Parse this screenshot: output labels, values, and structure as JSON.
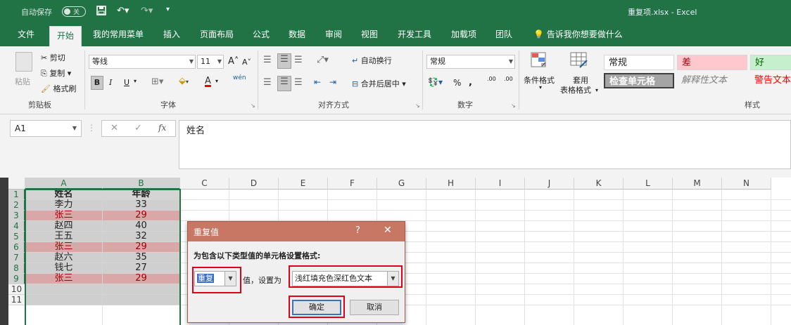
{
  "title_bar": {
    "autosave_label": "自动保存",
    "autosave_state": "关",
    "save_icon": "save-icon",
    "undo_icon": "undo-icon",
    "redo_icon": "redo-icon",
    "doc_title": "重复项.xlsx  -  Excel"
  },
  "tabs": [
    "文件",
    "开始",
    "我的常用菜单",
    "插入",
    "页面布局",
    "公式",
    "数据",
    "审阅",
    "视图",
    "开发工具",
    "加载项",
    "团队"
  ],
  "active_tab": "开始",
  "tell_me": "告诉我你想要做什么",
  "ribbon": {
    "clipboard": {
      "paste": "粘贴",
      "cut": "剪切",
      "copy": "复制",
      "format_painter": "格式刷",
      "label": "剪贴板"
    },
    "font": {
      "name": "等线",
      "size": "11",
      "grow": "A",
      "shrink": "A",
      "bold": "B",
      "italic": "I",
      "underline": "U",
      "phonetic": "wén",
      "font_color": "A",
      "label": "字体"
    },
    "alignment": {
      "wrap": "自动换行",
      "merge": "合并后居中",
      "label": "对齐方式"
    },
    "number": {
      "format": "常规",
      "percent": "%",
      "comma": ",",
      "inc_dec": ".00",
      "label": "数字"
    },
    "styles": {
      "conditional": "条件格式",
      "table_format_1": "套用",
      "table_format_2": "表格格式",
      "normal": "常规",
      "bad": "差",
      "good": "好",
      "check_cell": "检查单元格",
      "explanatory": "解释性文本",
      "warning": "警告文本",
      "label": "样式"
    }
  },
  "formula_bar": {
    "cell_ref": "A1",
    "cancel": "✕",
    "enter": "✓",
    "fx": "fx",
    "value": "姓名"
  },
  "columns": [
    "A",
    "B",
    "C",
    "D",
    "E",
    "F",
    "G",
    "H",
    "I",
    "J",
    "K",
    "L",
    "M",
    "N"
  ],
  "rows": [
    "1",
    "2",
    "3",
    "4",
    "5",
    "6",
    "7",
    "8",
    "9",
    "10",
    "11"
  ],
  "table": {
    "header": [
      "姓名",
      "年龄"
    ],
    "data": [
      [
        "李力",
        "33"
      ],
      [
        "张三",
        "29"
      ],
      [
        "赵四",
        "40"
      ],
      [
        "王五",
        "32"
      ],
      [
        "张三",
        "29"
      ],
      [
        "赵六",
        "35"
      ],
      [
        "钱七",
        "27"
      ],
      [
        "张三",
        "29"
      ]
    ]
  },
  "dialog": {
    "title": "重复值",
    "help": "?",
    "close": "✕",
    "message": "为包含以下类型值的单元格设置格式:",
    "type_value": "重复",
    "mid_text": "值，设置为",
    "format_value": "浅红填充色深红色文本",
    "ok": "确定",
    "cancel": "取消"
  },
  "colors": {
    "excel_green": "#217346",
    "dup_fill": "#d9a7a7",
    "dup_text": "#9c0006",
    "highlight_red": "#e0001b"
  }
}
